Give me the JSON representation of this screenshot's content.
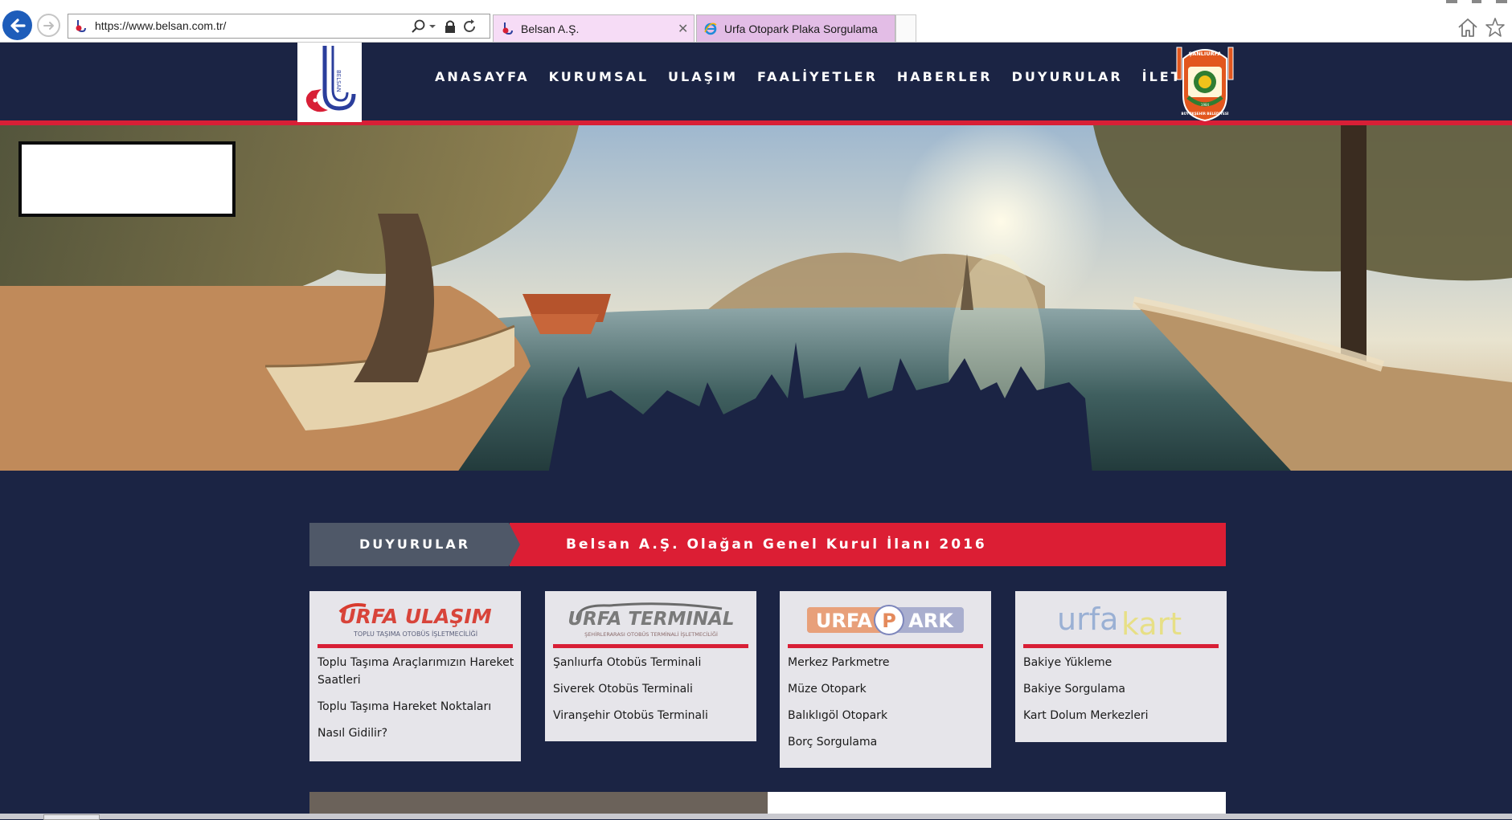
{
  "browser": {
    "url": "https://www.belsan.com.tr/",
    "tabs": [
      {
        "label": "Belsan A.Ş.",
        "active": true,
        "favicon": "belsan-favicon"
      },
      {
        "label": "Urfa Otopark Plaka Sorgulama",
        "active": false,
        "favicon": "ie-favicon"
      }
    ],
    "icons": [
      "back-arrow-icon",
      "forward-arrow-icon",
      "search-icon",
      "dropdown-icon",
      "lock-icon",
      "refresh-icon",
      "tab-close-icon",
      "home-icon",
      "favorites-star-icon"
    ]
  },
  "header": {
    "nav": [
      "ANASAYFA",
      "KURUMSAL",
      "ULAŞIM",
      "FAALİYETLER",
      "HABERLER",
      "DUYURULAR",
      "İLETİŞİM"
    ],
    "belsan_logo_text": "BELSAN",
    "municipal_logo_text": {
      "top": "ŞANLIURFA",
      "bottom": "BÜYÜKŞEHİR BELEDİYESİ",
      "year": "1984"
    },
    "colors": {
      "navy": "#1b2444",
      "red": "#d81f36"
    }
  },
  "announcement": {
    "label": "DUYURULAR",
    "headline": "Belsan A.Ş. Olağan Genel Kurul İlanı 2016"
  },
  "cards": [
    {
      "logo_title": "URFA ULAŞIM",
      "logo_subtitle": "TOPLU TAŞIMA OTOBÜS İŞLETMECİLİĞİ",
      "links": [
        "Toplu Taşıma Araçlarımızın Hareket Saatleri",
        "Toplu Taşıma Hareket Noktaları",
        "Nasıl Gidilir?"
      ]
    },
    {
      "logo_title": "URFA TERMINAL",
      "logo_subtitle": "ŞEHİRLERARASI OTOBÜS TERMİNALİ İŞLETMECİLİĞİ",
      "links": [
        "Şanlıurfa Otobüs Terminali",
        "Siverek Otobüs Terminali",
        "Viranşehir Otobüs Terminali"
      ]
    },
    {
      "logo_title_a": "URFA",
      "logo_title_p": "P",
      "logo_title_b": "ARK",
      "links": [
        "Merkez Parkmetre",
        "Müze Otopark",
        "Balıklıgöl Otopark",
        "Borç Sorgulama"
      ]
    },
    {
      "logo_title_a": "urfa",
      "logo_title_b": "kart",
      "links": [
        "Bakiye Yükleme",
        "Bakiye Sorgulama",
        "Kart Dolum Merkezleri"
      ]
    }
  ]
}
